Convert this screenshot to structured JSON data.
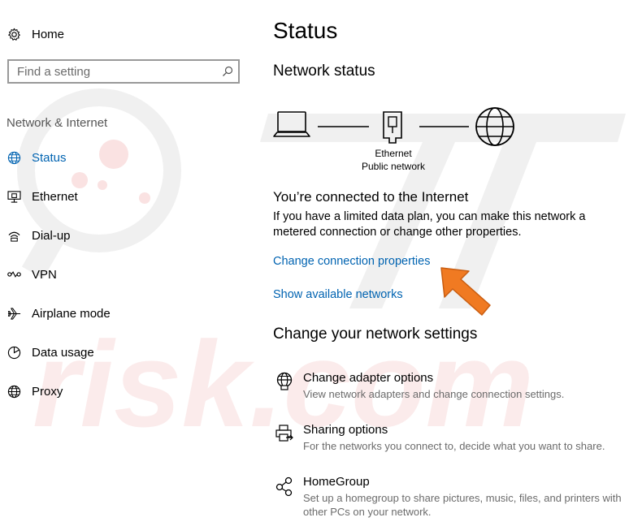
{
  "sidebar": {
    "home_label": "Home",
    "search_placeholder": "Find a setting",
    "section_header": "Network & Internet",
    "items": [
      {
        "label": "Status",
        "icon": "globe-status-icon",
        "active": true
      },
      {
        "label": "Ethernet",
        "icon": "ethernet-icon",
        "active": false
      },
      {
        "label": "Dial-up",
        "icon": "dialup-icon",
        "active": false
      },
      {
        "label": "VPN",
        "icon": "vpn-icon",
        "active": false
      },
      {
        "label": "Airplane mode",
        "icon": "airplane-icon",
        "active": false
      },
      {
        "label": "Data usage",
        "icon": "data-usage-icon",
        "active": false
      },
      {
        "label": "Proxy",
        "icon": "globe-icon",
        "active": false
      }
    ]
  },
  "main": {
    "title": "Status",
    "network_status_heading": "Network status",
    "diagram": {
      "adapter_name": "Ethernet",
      "network_type": "Public network"
    },
    "connected_heading": "You’re connected to the Internet",
    "connected_desc_line1": "If you have a limited data plan, you can make this network a",
    "connected_desc_line2": "metered connection or change other properties.",
    "change_connection_link": "Change connection properties",
    "show_networks_link": "Show available networks",
    "change_settings_heading": "Change your network settings",
    "settings": [
      {
        "title": "Change adapter options",
        "desc_line1": "View network adapters and change connection settings.",
        "desc_line2": "",
        "icon": "adapter-globe-icon"
      },
      {
        "title": "Sharing options",
        "desc_line1": "For the networks you connect to, decide what you want to share.",
        "desc_line2": "",
        "icon": "sharing-printer-icon"
      },
      {
        "title": "HomeGroup",
        "desc_line1": "Set up a homegroup to share pictures, music, files, and printers with",
        "desc_line2": "other PCs on your network.",
        "icon": "homegroup-icon"
      }
    ]
  },
  "colors": {
    "accent": "#0063b1",
    "annotation_arrow": "#f07a22",
    "watermark": "#e8a0a0"
  }
}
